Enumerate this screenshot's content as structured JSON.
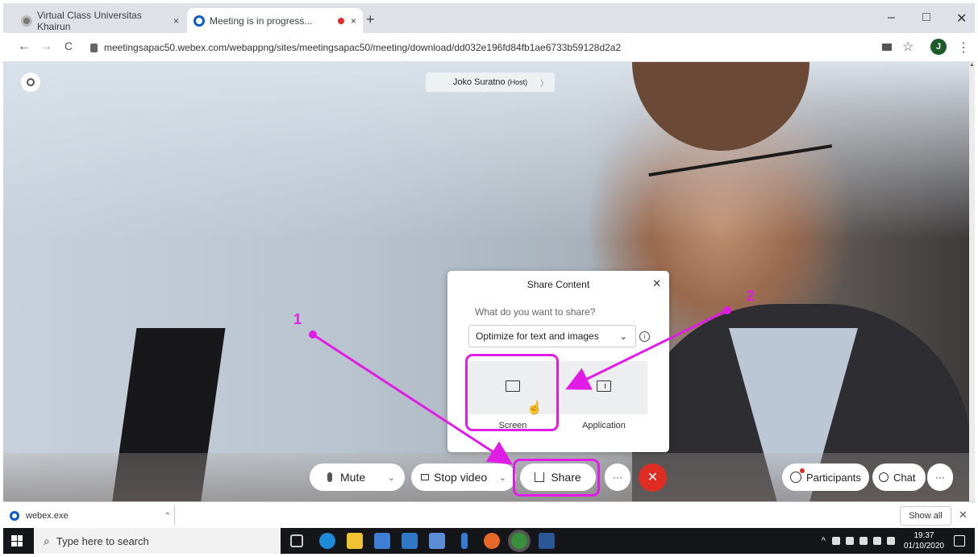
{
  "tabs": [
    {
      "label": "Virtual Class Universitas Khairun",
      "close": "×"
    },
    {
      "label": "Meeting is in progress...",
      "close": "×"
    }
  ],
  "new_tab": "+",
  "window_controls": {
    "minimize": "–",
    "maximize": "□",
    "close": "✕"
  },
  "nav": {
    "back": "←",
    "forward": "→",
    "reload": "C"
  },
  "address_url": "meetingsapac50.webex.com/webappng/sites/meetingsapac50/meeting/download/dd032e196fd84fb1ae6733b59128d2a2",
  "profile_initial": "J",
  "host": {
    "name": "Joko Suratno",
    "tag": "(Host)"
  },
  "share_popup": {
    "title": "Share Content",
    "question": "What do you want to share?",
    "optimize_value": "Optimize for text and images",
    "option_screen": "Screen",
    "option_app": "Application"
  },
  "controls": {
    "mute": "Mute",
    "stop_video": "Stop video",
    "share": "Share",
    "more": "···",
    "end": "✕",
    "participants": "Participants",
    "chat": "Chat"
  },
  "annotations": {
    "one": "1",
    "two": "2",
    "color": "#e11ce6"
  },
  "download": {
    "file": "webex.exe",
    "show_all": "Show all",
    "close": "✕"
  },
  "taskbar": {
    "search_placeholder": "Type here to search",
    "time": "19:37",
    "date": "01/10/2020"
  },
  "colors": {
    "end_call": "#e02d24",
    "webex_blue": "#0a5cc2",
    "highlight": "#e11ce6"
  }
}
